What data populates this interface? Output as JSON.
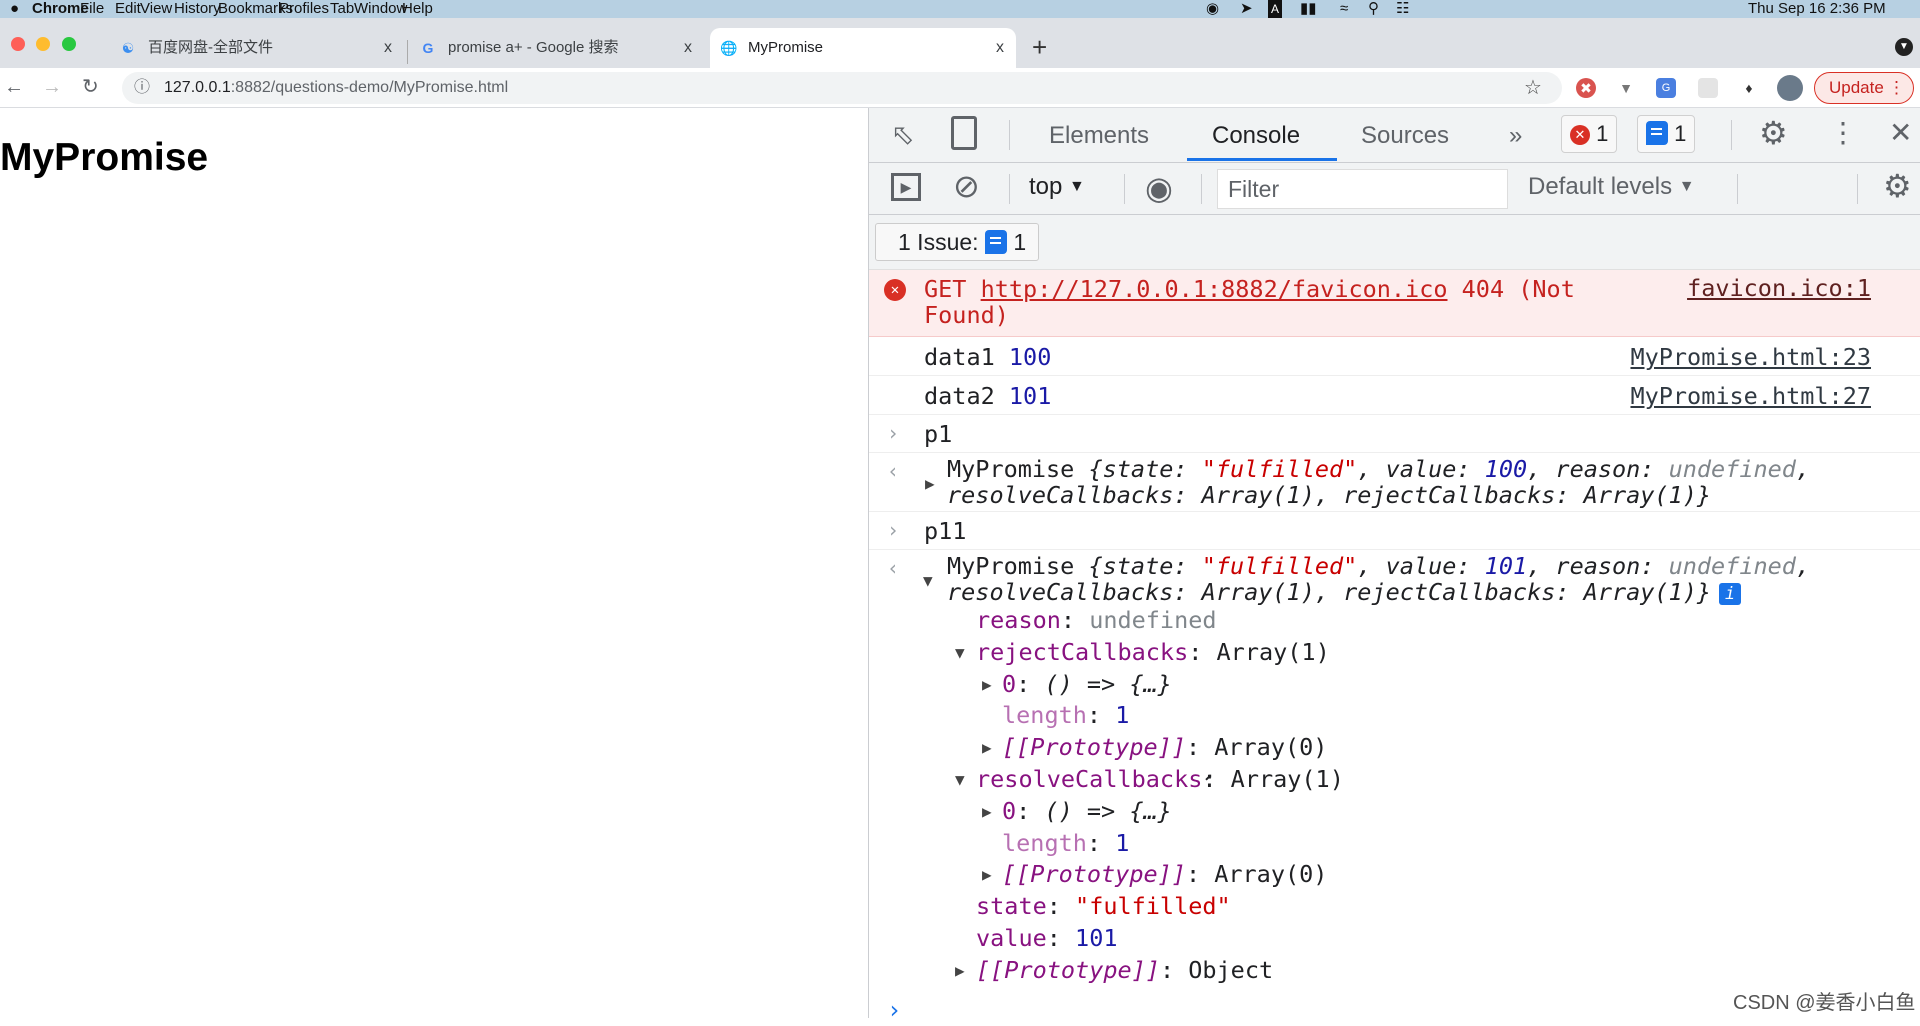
{
  "menubar": {
    "apple": "",
    "app": "Chrome",
    "items": [
      "File",
      "Edit",
      "View",
      "History",
      "Bookmarks",
      "Profiles",
      "Tab",
      "Window",
      "Help"
    ],
    "clock": "Thu Sep 16  2:36 PM",
    "status_icons": [
      "record-icon",
      "paper-plane-icon",
      "input-method-icon",
      "battery-icon",
      "wifi-icon",
      "spotlight-icon",
      "control-center-icon"
    ]
  },
  "tabs": [
    {
      "title": "百度网盘-全部文件",
      "icon": "baidu-cloud-icon",
      "close": "x"
    },
    {
      "title": "promise a+ - Google 搜索",
      "icon": "google-icon",
      "close": "x"
    },
    {
      "title": "MyPromise",
      "icon": "globe-icon",
      "close": "x",
      "active": true
    }
  ],
  "new_tab": "+",
  "address": {
    "host": "127.0.0.1",
    "rest": ":8882/questions-demo/MyPromise.html"
  },
  "update_label": "Update",
  "page": {
    "heading": "MyPromise"
  },
  "devtools": {
    "tabs": [
      "Elements",
      "Console",
      "Sources"
    ],
    "active_tab": "Console",
    "more": "»",
    "error_count": "1",
    "issue_count": "1",
    "context": "top",
    "filter_placeholder": "Filter",
    "levels": "Default levels",
    "issues_label": "1 Issue:",
    "issues_count": "1"
  },
  "console": {
    "error": {
      "method": "GET",
      "url": "http://127.0.0.1:8882/favicon.ico",
      "status": "404 (Not Found)",
      "source": "favicon.ico:1"
    },
    "logs": [
      {
        "label": "data1",
        "value": "100",
        "source": "MyPromise.html:23"
      },
      {
        "label": "data2",
        "value": "101",
        "source": "MyPromise.html:27"
      }
    ],
    "inputs": [
      "p1",
      "p11"
    ],
    "p1_result": {
      "cls": "MyPromise",
      "state": "\"fulfilled\"",
      "value": "100",
      "reason": "undefined",
      "rest": "resolveCallbacks: Array(1), rejectCallbacks: Array(1)}"
    },
    "p11_result": {
      "cls": "MyPromise",
      "state": "\"fulfilled\"",
      "value": "101",
      "reason": "undefined",
      "rest": "resolveCallbacks: Array(1), rejectCallbacks: Array(1)}",
      "info": "i"
    },
    "tree": {
      "reason_key": "reason",
      "reason_val": "undefined",
      "reject_key": "rejectCallbacks",
      "reject_val": "Array(1)",
      "item0_key": "0",
      "item0_val": "() => {…}",
      "length_key": "length",
      "length_val": "1",
      "proto_key": "[[Prototype]]",
      "proto_arr": "Array(0)",
      "resolve_key": "resolveCallbacks",
      "resolve_val": "Array(1)",
      "state_key": "state",
      "state_val": "\"fulfilled\"",
      "value_key": "value",
      "value_val": "101",
      "proto_obj": "Object"
    },
    "prompt": "›"
  },
  "watermark": "CSDN @姜香小白鱼"
}
